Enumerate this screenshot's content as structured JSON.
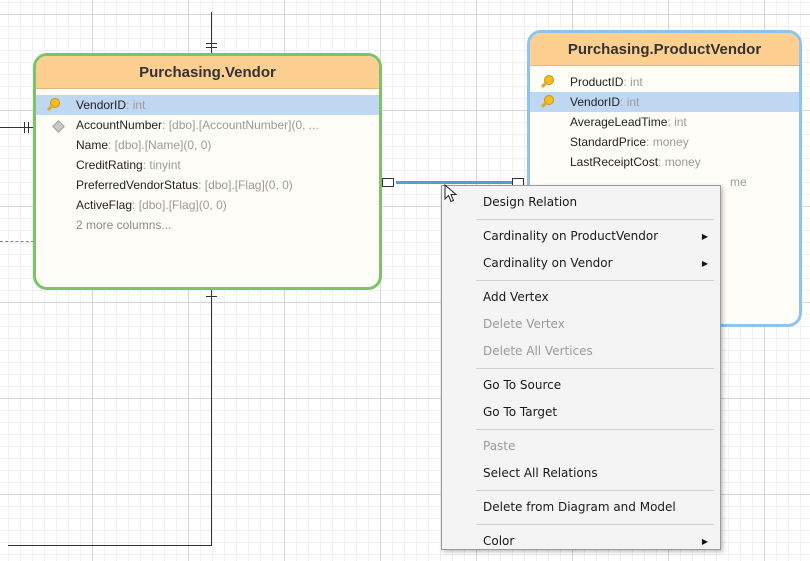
{
  "vendor_table": {
    "title": "Purchasing.Vendor",
    "columns": [
      {
        "name": "VendorID",
        "type": ": int",
        "icon": "primary-key-icon",
        "selected": true
      },
      {
        "name": "AccountNumber",
        "type": ": [dbo].[AccountNumber](0, ...",
        "icon": "column-diamond-icon"
      },
      {
        "name": "Name",
        "type": ": [dbo].[Name](0, 0)"
      },
      {
        "name": "CreditRating",
        "type": ": tinyint"
      },
      {
        "name": "PreferredVendorStatus",
        "type": ": [dbo].[Flag](0, 0)"
      },
      {
        "name": "ActiveFlag",
        "type": ": [dbo].[Flag](0, 0)"
      }
    ],
    "more": "2 more columns..."
  },
  "product_vendor_table": {
    "title": "Purchasing.ProductVendor",
    "columns": [
      {
        "name": "ProductID",
        "type": ": int",
        "icon": "primary-key-icon"
      },
      {
        "name": "VendorID",
        "type": ": int",
        "icon": "primary-key-icon",
        "selected": true
      },
      {
        "name": "AverageLeadTime",
        "type": ": int"
      },
      {
        "name": "StandardPrice",
        "type": ": money"
      },
      {
        "name": "LastReceiptCost",
        "type": ": money"
      },
      {
        "name": "",
        "type": "me"
      }
    ]
  },
  "context_menu": {
    "items": [
      {
        "label": "Design Relation"
      },
      {
        "separator": true
      },
      {
        "label": "Cardinality on ProductVendor",
        "submenu": true
      },
      {
        "label": "Cardinality on Vendor",
        "submenu": true
      },
      {
        "separator": true
      },
      {
        "label": "Add Vertex"
      },
      {
        "label": "Delete Vertex",
        "disabled": true
      },
      {
        "label": "Delete All Vertices",
        "disabled": true
      },
      {
        "separator": true
      },
      {
        "label": "Go To Source"
      },
      {
        "label": "Go To Target"
      },
      {
        "separator": true
      },
      {
        "label": "Paste",
        "disabled": true
      },
      {
        "label": "Select All Relations"
      },
      {
        "separator": true
      },
      {
        "label": "Delete from Diagram and Model"
      },
      {
        "separator": true
      },
      {
        "label": "Color",
        "submenu": true
      }
    ]
  },
  "colors": {
    "vendor_border": "#7cc46a",
    "product_vendor_border": "#8dc4ee",
    "header_fill": "#fdd091",
    "selected_row": "#c0d7f2",
    "relation_line": "#5b9bd5"
  }
}
